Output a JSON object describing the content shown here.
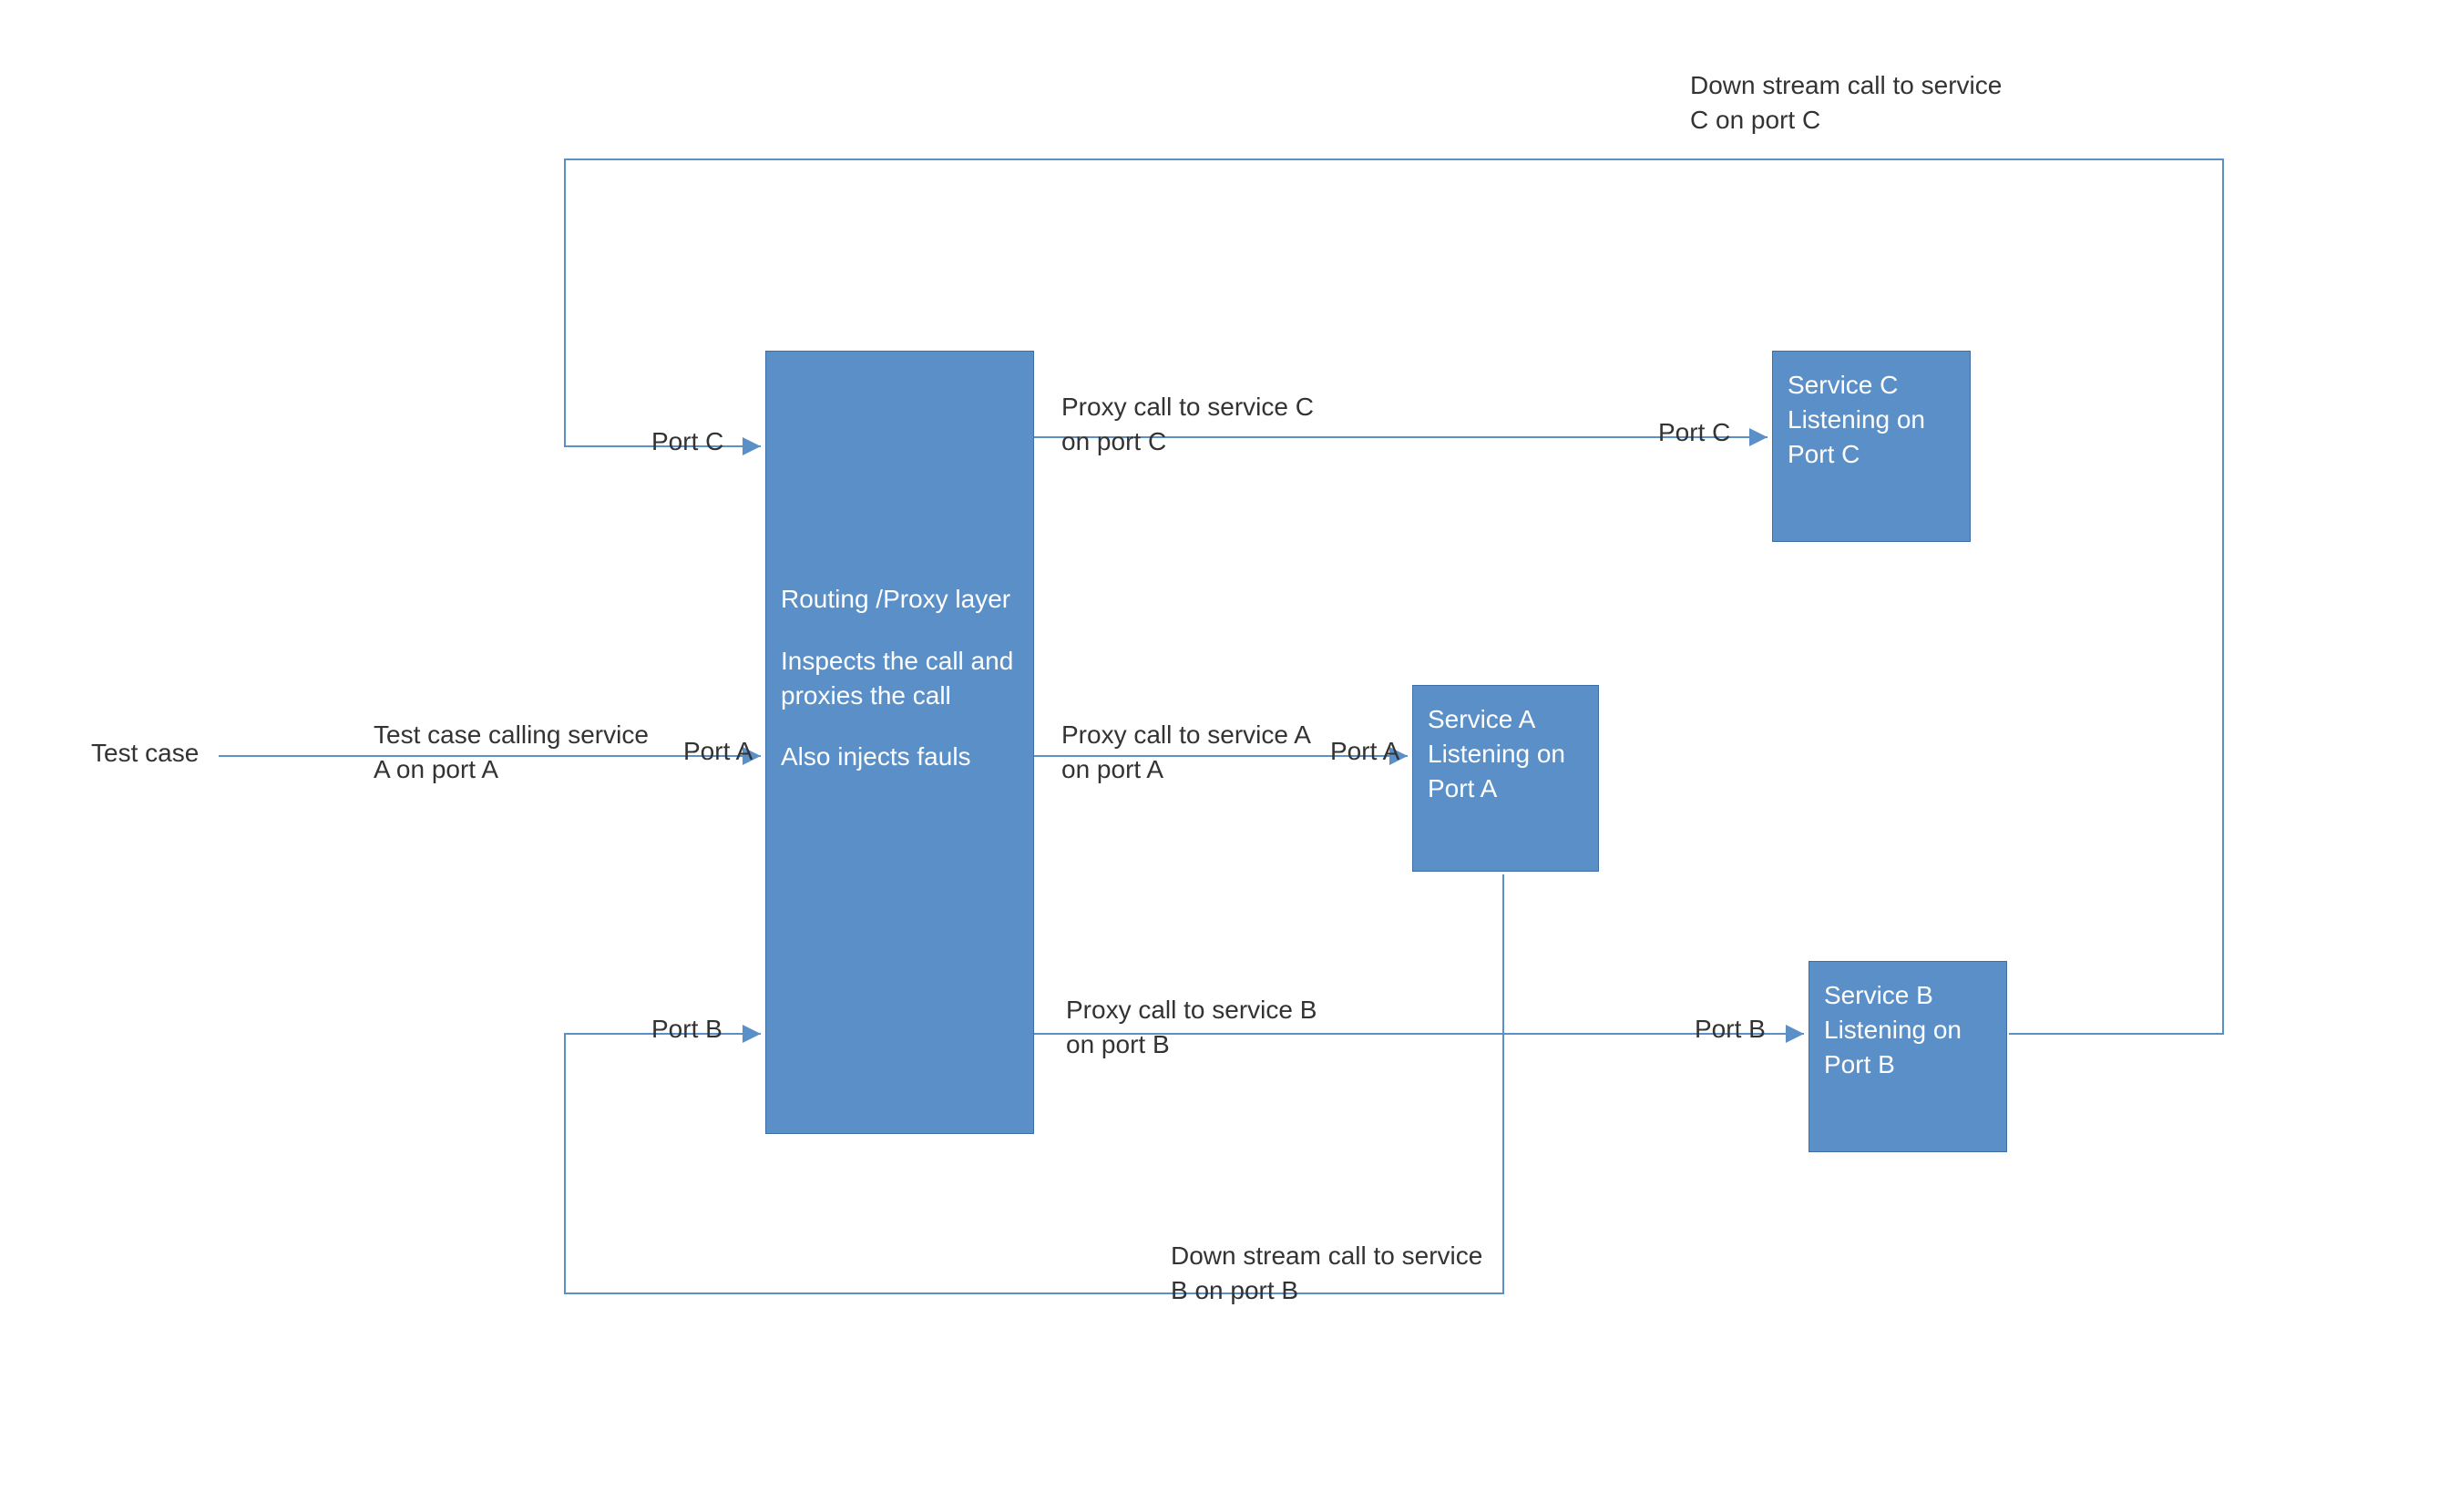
{
  "colors": {
    "box_fill": "#5B8FC8",
    "box_text": "#ffffff",
    "line": "#5B8FC8",
    "text": "#333333"
  },
  "testcase_label": "Test case",
  "proxy": {
    "line1": "Routing /Proxy layer",
    "line2": "Inspects the call and proxies the call",
    "line3": "Also  injects fauls"
  },
  "services": {
    "a": "Service A Listening on Port A",
    "b": "Service B Listening on Port B",
    "c": "Service C Listening on Port C"
  },
  "port_labels": {
    "a_left": "Port A",
    "b_left": "Port B",
    "c_left": "Port C",
    "a_right": "Port A",
    "b_right": "Port B",
    "c_right": "Port C"
  },
  "edge_labels": {
    "testcase_to_proxy": "Test case calling service A on port A",
    "proxy_to_a": "Proxy call to service A on port A",
    "proxy_to_b": "Proxy call to service B on port B",
    "proxy_to_c": "Proxy call to service C on port C",
    "downstream_b": "Down stream call to service B on port B",
    "downstream_c": "Down stream call to service C on port C"
  }
}
